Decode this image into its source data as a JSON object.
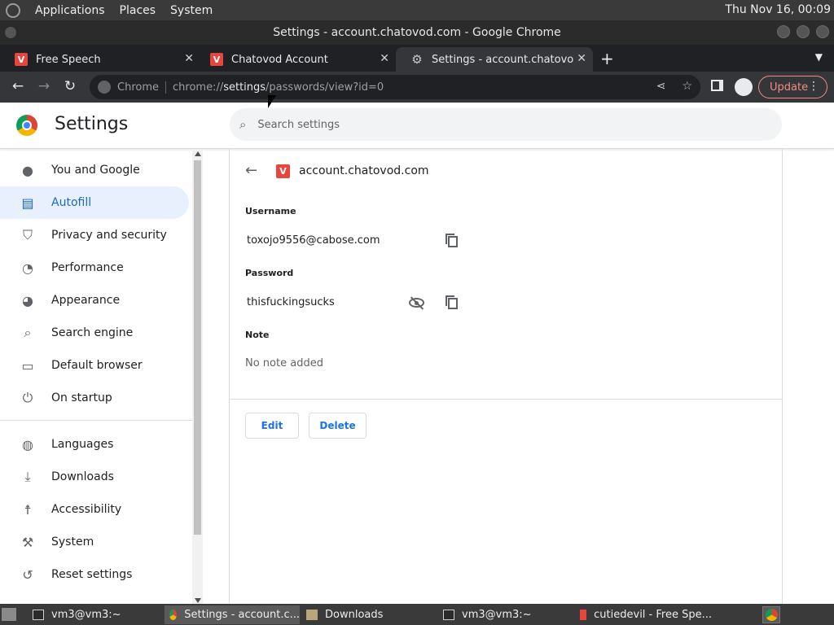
{
  "desktop": {
    "menu": [
      "Applications",
      "Places",
      "System"
    ],
    "clock": "Thu Nov 16, 00:09"
  },
  "window": {
    "title": "Settings - account.chatovod.com - Google Chrome"
  },
  "tabs": [
    {
      "title": "Free Speech",
      "favicon": "v-icon",
      "close": "✕"
    },
    {
      "title": "Chatovod Account",
      "favicon": "v-icon",
      "close": "✕"
    },
    {
      "title": "Settings - account.chatovod.com",
      "favicon": "gear-icon",
      "close": "✕"
    }
  ],
  "toolbar": {
    "chrome_label": "Chrome",
    "url_scheme": "chrome://",
    "url_host": "settings",
    "url_path": "/passwords/view?id=0",
    "update_label": "Update"
  },
  "settings": {
    "title": "Settings",
    "search_placeholder": "Search settings"
  },
  "sidebar": {
    "items": [
      {
        "label": "You and Google",
        "icon": "person-icon"
      },
      {
        "label": "Autofill",
        "icon": "clipboard-icon"
      },
      {
        "label": "Privacy and security",
        "icon": "shield-icon"
      },
      {
        "label": "Performance",
        "icon": "speedometer-icon"
      },
      {
        "label": "Appearance",
        "icon": "palette-icon"
      },
      {
        "label": "Search engine",
        "icon": "search-icon"
      },
      {
        "label": "Default browser",
        "icon": "browser-icon"
      },
      {
        "label": "On startup",
        "icon": "power-icon"
      },
      {
        "label": "Languages",
        "icon": "globe-icon"
      },
      {
        "label": "Downloads",
        "icon": "download-icon"
      },
      {
        "label": "Accessibility",
        "icon": "accessibility-icon"
      },
      {
        "label": "System",
        "icon": "wrench-icon"
      },
      {
        "label": "Reset settings",
        "icon": "history-icon"
      }
    ]
  },
  "password_detail": {
    "site": "account.chatovod.com",
    "username_label": "Username",
    "username": "toxojo9556@cabose.com",
    "password_label": "Password",
    "password": "thisfuckingsucks",
    "note_label": "Note",
    "note": "No note added",
    "edit_label": "Edit",
    "delete_label": "Delete"
  },
  "taskbar": {
    "items": [
      {
        "label": "vm3@vm3:~"
      },
      {
        "label": "Settings - account.c..."
      },
      {
        "label": "Downloads"
      },
      {
        "label": "vm3@vm3:~"
      },
      {
        "label": "cutiedevil - Free Spe..."
      }
    ]
  }
}
